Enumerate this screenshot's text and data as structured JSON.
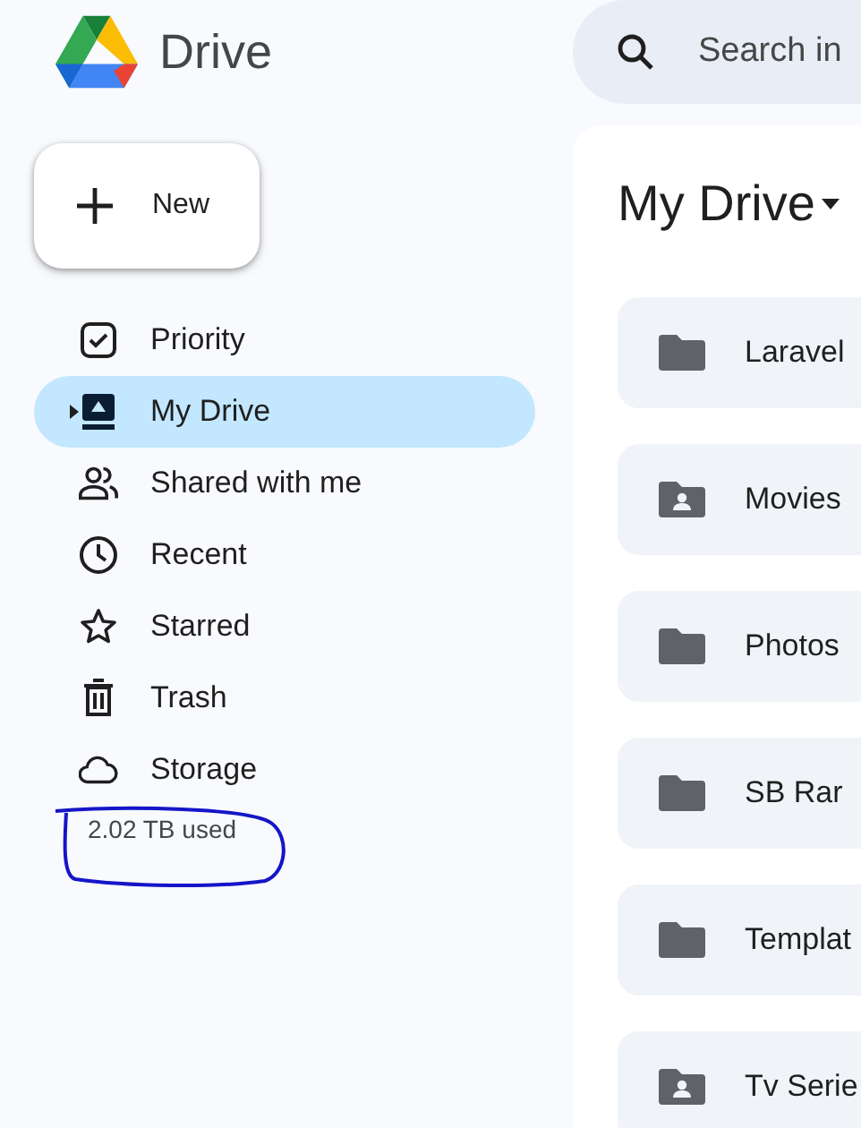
{
  "app": {
    "title": "Drive"
  },
  "new_button": {
    "label": "New"
  },
  "sidebar": {
    "items": [
      {
        "label": "Priority",
        "kind": "priority",
        "selected": false,
        "has_caret": false
      },
      {
        "label": "My Drive",
        "kind": "drive",
        "selected": true,
        "has_caret": true
      },
      {
        "label": "Shared with me",
        "kind": "shared",
        "selected": false,
        "has_caret": false
      },
      {
        "label": "Recent",
        "kind": "recent",
        "selected": false,
        "has_caret": false
      },
      {
        "label": "Starred",
        "kind": "starred",
        "selected": false,
        "has_caret": false
      },
      {
        "label": "Trash",
        "kind": "trash",
        "selected": false,
        "has_caret": false
      },
      {
        "label": "Storage",
        "kind": "storage",
        "selected": false,
        "has_caret": false
      }
    ],
    "storage_used": "2.02 TB used"
  },
  "search": {
    "placeholder": "Search in"
  },
  "main": {
    "title": "My Drive",
    "folders": [
      {
        "name": "Laravel",
        "kind": "folder"
      },
      {
        "name": "Movies",
        "kind": "shared"
      },
      {
        "name": "Photos",
        "kind": "folder"
      },
      {
        "name": "SB Rar",
        "kind": "folder"
      },
      {
        "name": "Templat",
        "kind": "folder"
      },
      {
        "name": "Tv Serie",
        "kind": "shared"
      }
    ]
  }
}
